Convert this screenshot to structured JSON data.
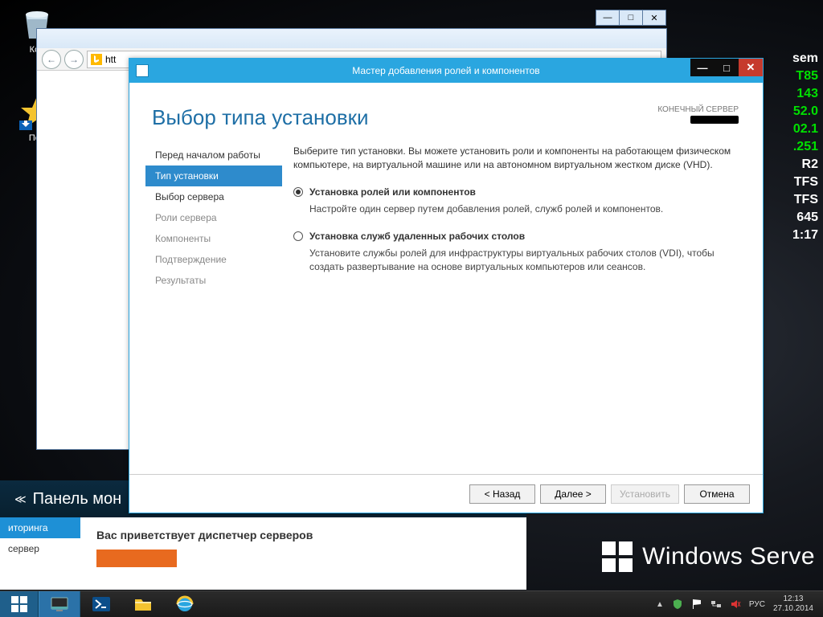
{
  "desktop_icons": {
    "recycle": "Кор",
    "connect": "Пол"
  },
  "bginfo": [
    "sem",
    "T85",
    "143",
    "52.0",
    "02.1",
    ".251",
    "R2",
    "TFS",
    "TFS",
    "645",
    "1:17"
  ],
  "wslogo_text": "Windows Serve",
  "ie": {
    "addr_prefix": "htt"
  },
  "sm": {
    "bar_title": "Панель мон",
    "side_sel": "иторинга",
    "side_item": "сервер",
    "welcome": "Вас приветствует диспетчер серверов"
  },
  "wizard": {
    "title": "Мастер добавления ролей и компонентов",
    "heading": "Выбор типа установки",
    "dest_label": "КОНЕЧНЫЙ СЕРВЕР",
    "steps": [
      "Перед началом работы",
      "Тип установки",
      "Выбор сервера",
      "Роли сервера",
      "Компоненты",
      "Подтверждение",
      "Результаты"
    ],
    "intro": "Выберите тип установки. Вы можете установить роли и компоненты на работающем физическом компьютере, на виртуальной машине или на автономном виртуальном жестком диске (VHD).",
    "opt1_title": "Установка ролей или компонентов",
    "opt1_desc": "Настройте один сервер путем добавления ролей, служб ролей и компонентов.",
    "opt2_title": "Установка служб удаленных рабочих столов",
    "opt2_desc": "Установите службы ролей для инфраструктуры виртуальных рабочих столов (VDI), чтобы создать развертывание на основе виртуальных компьютеров или сеансов.",
    "btn_back": "< Назад",
    "btn_next": "Далее >",
    "btn_install": "Установить",
    "btn_cancel": "Отмена"
  },
  "tray": {
    "lang": "РУС",
    "time": "12:13",
    "date": "27.10.2014"
  }
}
